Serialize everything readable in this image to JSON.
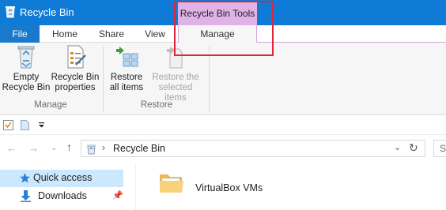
{
  "window": {
    "title": "Recycle Bin"
  },
  "context_tab_header": "Recycle Bin Tools",
  "tabs": {
    "file": "File",
    "home": "Home",
    "share": "Share",
    "view": "View",
    "manage": "Manage"
  },
  "ribbon": {
    "empty_bin": "Empty\nRecycle Bin",
    "properties": "Recycle Bin\nproperties",
    "restore_all": "Restore\nall items",
    "restore_selected": "Restore the\nselected items",
    "group_manage": "Manage",
    "group_restore": "Restore"
  },
  "address": {
    "path": "Recycle Bin",
    "search_placeholder": "Se"
  },
  "navigation": {
    "items": [
      {
        "label": "Quick access",
        "selected": true
      },
      {
        "label": "Downloads",
        "selected": false
      }
    ]
  },
  "content": {
    "items": [
      {
        "label": "VirtualBox VMs"
      }
    ]
  },
  "colors": {
    "titlebar": "#0f7bd7",
    "file_tab": "#1979ca",
    "context_tab": "#dfb3e6",
    "highlight_box": "#e0243a"
  }
}
